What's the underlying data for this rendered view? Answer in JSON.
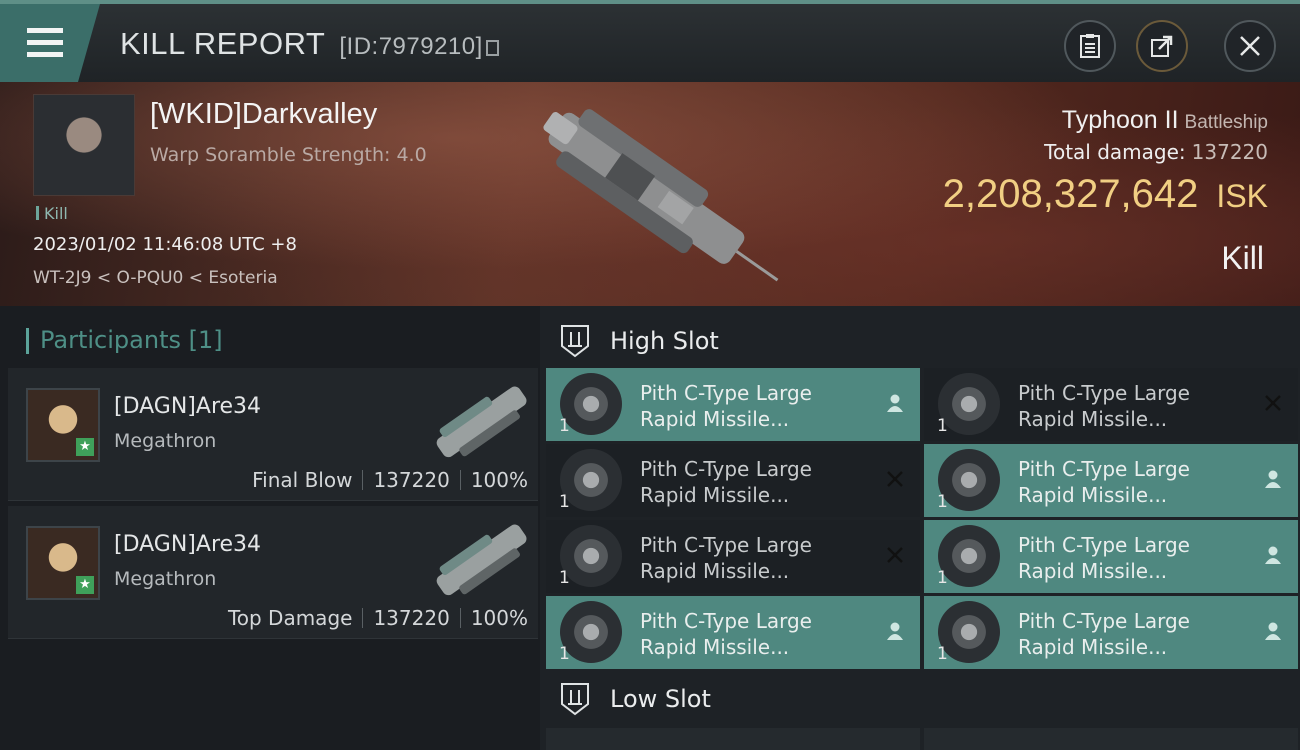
{
  "window": {
    "title": "KILL REPORT",
    "id_label": "[ID:7979210]"
  },
  "victim": {
    "name": "[WKID]Darkvalley",
    "detail": "Warp Soramble Strength: 4.0",
    "tag": "Kill",
    "datetime": "2023/01/02 11:46:08 UTC +8",
    "location": "WT-2J9 < O-PQU0 < Esoteria",
    "ship_name": "Typhoon II",
    "ship_class": "Battleship",
    "damage_label": "Total damage:",
    "damage_value": "137220",
    "isk_value": "2,208,327,642",
    "isk_unit": "ISK",
    "result": "Kill"
  },
  "participants": {
    "header": "Participants [1]",
    "items": [
      {
        "name": "[DAGN]Are34",
        "ship": "Megathron",
        "role": "Final Blow",
        "damage": "137220",
        "percent": "100%"
      },
      {
        "name": "[DAGN]Are34",
        "ship": "Megathron",
        "role": "Top Damage",
        "damage": "137220",
        "percent": "100%"
      }
    ]
  },
  "fitting": {
    "high_slot_label": "High Slot",
    "low_slot_label": "Low Slot",
    "high_modules": [
      {
        "line1": "Pith C-Type Large",
        "line2": "Rapid Missile...",
        "qty": "1",
        "status": "dropped"
      },
      {
        "line1": "Pith C-Type Large",
        "line2": "Rapid Missile...",
        "qty": "1",
        "status": "destroyed"
      },
      {
        "line1": "Pith C-Type Large",
        "line2": "Rapid Missile...",
        "qty": "1",
        "status": "destroyed"
      },
      {
        "line1": "Pith C-Type Large",
        "line2": "Rapid Missile...",
        "qty": "1",
        "status": "dropped"
      },
      {
        "line1": "Pith C-Type Large",
        "line2": "Rapid Missile...",
        "qty": "1",
        "status": "destroyed"
      },
      {
        "line1": "Pith C-Type Large",
        "line2": "Rapid Missile...",
        "qty": "1",
        "status": "dropped"
      },
      {
        "line1": "Pith C-Type Large",
        "line2": "Rapid Missile...",
        "qty": "1",
        "status": "dropped"
      },
      {
        "line1": "Pith C-Type Large",
        "line2": "Rapid Missile...",
        "qty": "1",
        "status": "dropped"
      }
    ]
  },
  "colors": {
    "accent": "#4f8880",
    "isk": "#f1cf83",
    "menu": "#3b6e69"
  },
  "icons": [
    "menu-icon",
    "clipboard-icon",
    "share-icon",
    "close-icon",
    "slot-icon",
    "person-icon",
    "cross-icon"
  ]
}
